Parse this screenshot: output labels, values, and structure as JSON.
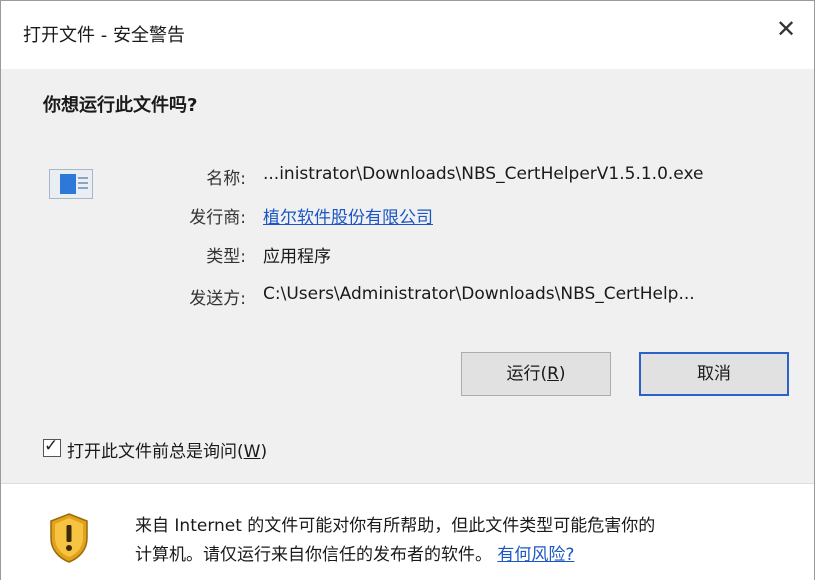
{
  "dialog": {
    "title": "打开文件 - 安全警告",
    "close_glyph": "✕",
    "question": "你想运行此文件吗?",
    "fields": {
      "name_label": "名称:",
      "name_value": "...inistrator\\Downloads\\NBS_CertHelperV1.5.1.0.exe",
      "publisher_label": "发行商:",
      "publisher_value": "植尔软件股份有限公司",
      "type_label": "类型:",
      "type_value": "应用程序",
      "from_label": "发送方:",
      "from_value": "C:\\Users\\Administrator\\Downloads\\NBS_CertHelp..."
    },
    "buttons": {
      "run_text": "运行(",
      "run_key": "R",
      "run_end": ")",
      "cancel_label": "取消"
    },
    "checkbox": {
      "checked": true,
      "check_glyph": "✓",
      "label_text": "打开此文件前总是询问(",
      "label_key": "W",
      "label_end": ")"
    },
    "footer": {
      "warning": "来自 Internet 的文件可能对你有所帮助，但此文件类型可能危害你的",
      "warning_line2": "计算机。请仅运行来自你信任的发布者的软件。",
      "risk_link": "有何风险?"
    },
    "icons": {
      "file": "exe-file-icon",
      "shield": "warning-shield-icon",
      "close": "close-icon"
    },
    "colors": {
      "link": "#1b57c4",
      "cancel_border": "#2b62c8",
      "shield_gold": "#e2a21b"
    }
  }
}
